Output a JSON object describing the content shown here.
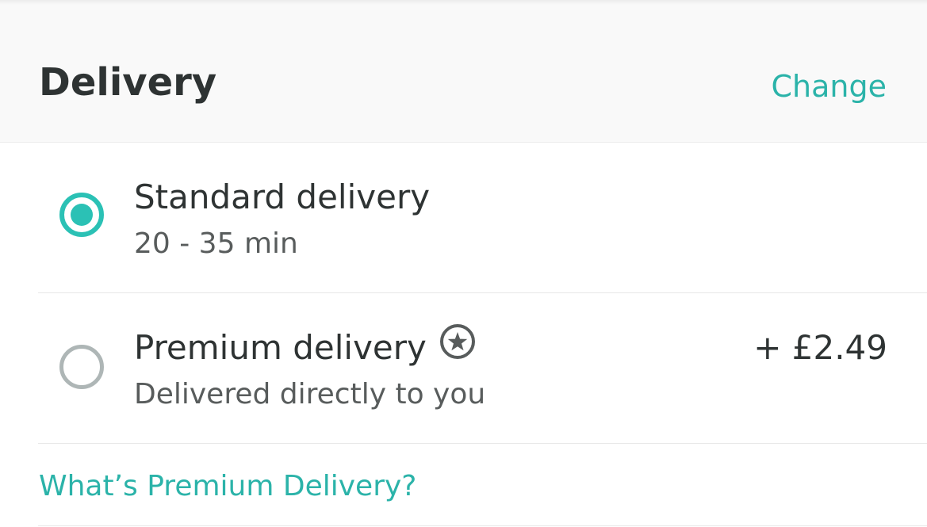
{
  "header": {
    "title": "Delivery",
    "change_label": "Change"
  },
  "options": [
    {
      "title": "Standard delivery",
      "subtitle": "20 - 35 min",
      "selected": true
    },
    {
      "title": "Premium delivery",
      "subtitle": "Delivered directly to you",
      "price": "+ £2.49",
      "icon": "star-circle-icon",
      "selected": false
    }
  ],
  "premium_link": "What’s Premium Delivery?",
  "colors": {
    "accent": "#2bc1b5",
    "link": "#2bb3a9",
    "text": "#2e3333",
    "subtext": "#585c5c",
    "radio_unselected": "#aeb6b6",
    "header_bg": "#f9f9f9"
  }
}
